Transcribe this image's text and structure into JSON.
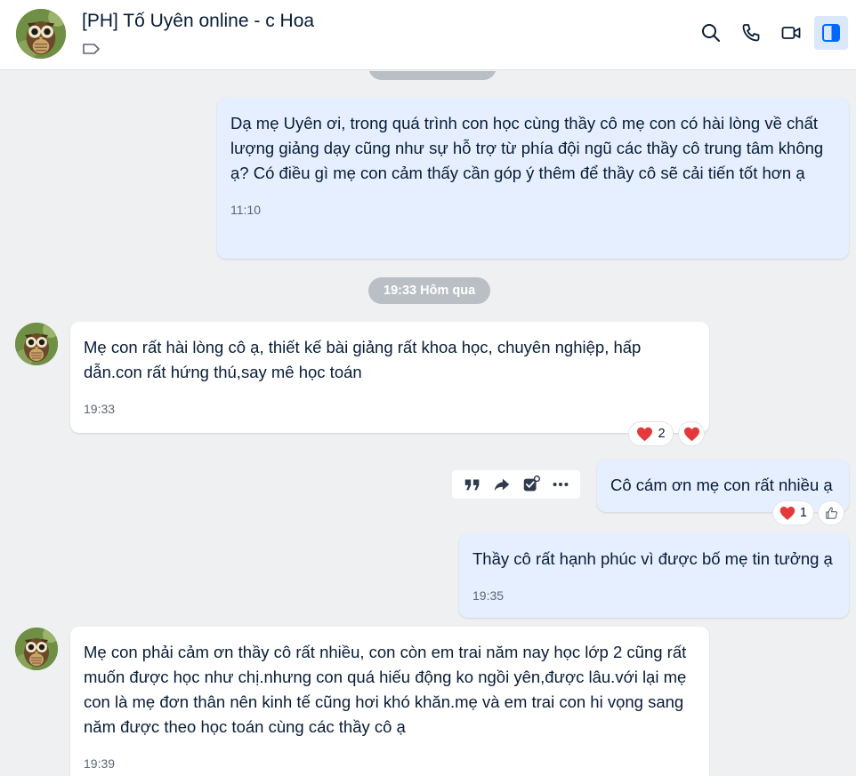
{
  "header": {
    "title": "[PH] Tố Uyên online - c Hoa",
    "icons": [
      "owl-avatar",
      "tag-icon",
      "search-icon",
      "phone-icon",
      "video-icon",
      "sidebar-toggle-icon"
    ]
  },
  "colors": {
    "my_bubble": "#e5efff",
    "their_bubble": "#ffffff",
    "background": "#eef0f1",
    "accent": "#0068ff",
    "heart": "#e5383b"
  },
  "messages": [
    {
      "sender": "me",
      "text": "Dạ mẹ Uyên ơi, trong quá trình con học cùng thầy cô mẹ con có hài lòng về chất lượng giảng dạy cũng như sự hỗ trợ từ phía đội ngũ các thầy cô trung tâm không ạ? Có điều gì mẹ con cảm thấy cần góp ý thêm để thầy cô sẽ cải tiến tốt hơn ạ",
      "time": "11:10"
    },
    {
      "sender": "divider",
      "text": "19:33 Hôm qua"
    },
    {
      "sender": "them",
      "text": "Mẹ con rất hài lòng cô ạ, thiết kế bài giảng rất khoa học, chuyên nghiệp, hấp dẫn.con rất hứng thú,say mê học toán",
      "time": "19:33",
      "reaction_count": "2"
    },
    {
      "sender": "me",
      "text": "Cô cám ơn mẹ con rất nhiều ạ",
      "reaction_count": "1"
    },
    {
      "sender": "me",
      "text": "Thầy cô rất hạnh phúc vì được bố mẹ tin tưởng ạ",
      "time": "19:35"
    },
    {
      "sender": "them",
      "text": "Mẹ con phải cảm ơn thầy cô rất nhiều, con còn em trai năm nay học lớp 2 cũng rất muốn được học như chị.nhưng con quá hiếu động ko ngồi yên,được lâu.với lại mẹ con là mẹ đơn thân nên kinh tế cũng hơi khó khăn.mẹ và em trai con hi vọng sang năm được theo học toán cùng các thầy cô ạ",
      "time": "19:39"
    }
  ],
  "message_actions": [
    "quote-icon",
    "forward-icon",
    "task-icon",
    "more-icon"
  ]
}
